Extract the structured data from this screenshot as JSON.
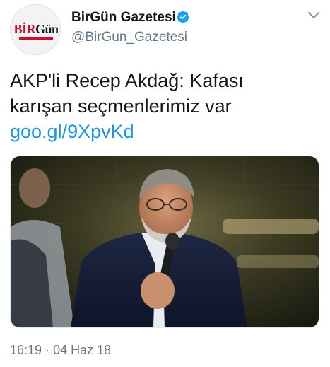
{
  "account": {
    "display_name": "BirGün Gazetesi",
    "handle": "@BirGun_Gazetesi",
    "verified": true,
    "avatar_logo": {
      "part1": "BİR",
      "part2": "Gün"
    }
  },
  "tweet": {
    "text_line1": "AKP'li Recep Akdağ: Kafası",
    "text_line2": "karışan seçmenlerimiz var",
    "link": "goo.gl/9XpvKd",
    "time": "16:19",
    "separator": "·",
    "date": "04 Haz 18"
  },
  "icons": {
    "verified": "verified-badge-icon",
    "menu": "chevron-down-icon"
  },
  "colors": {
    "link": "#1b95e0",
    "verified": "#1da1f2",
    "secondary_text": "#657786",
    "brand_red": "#c8102e"
  }
}
